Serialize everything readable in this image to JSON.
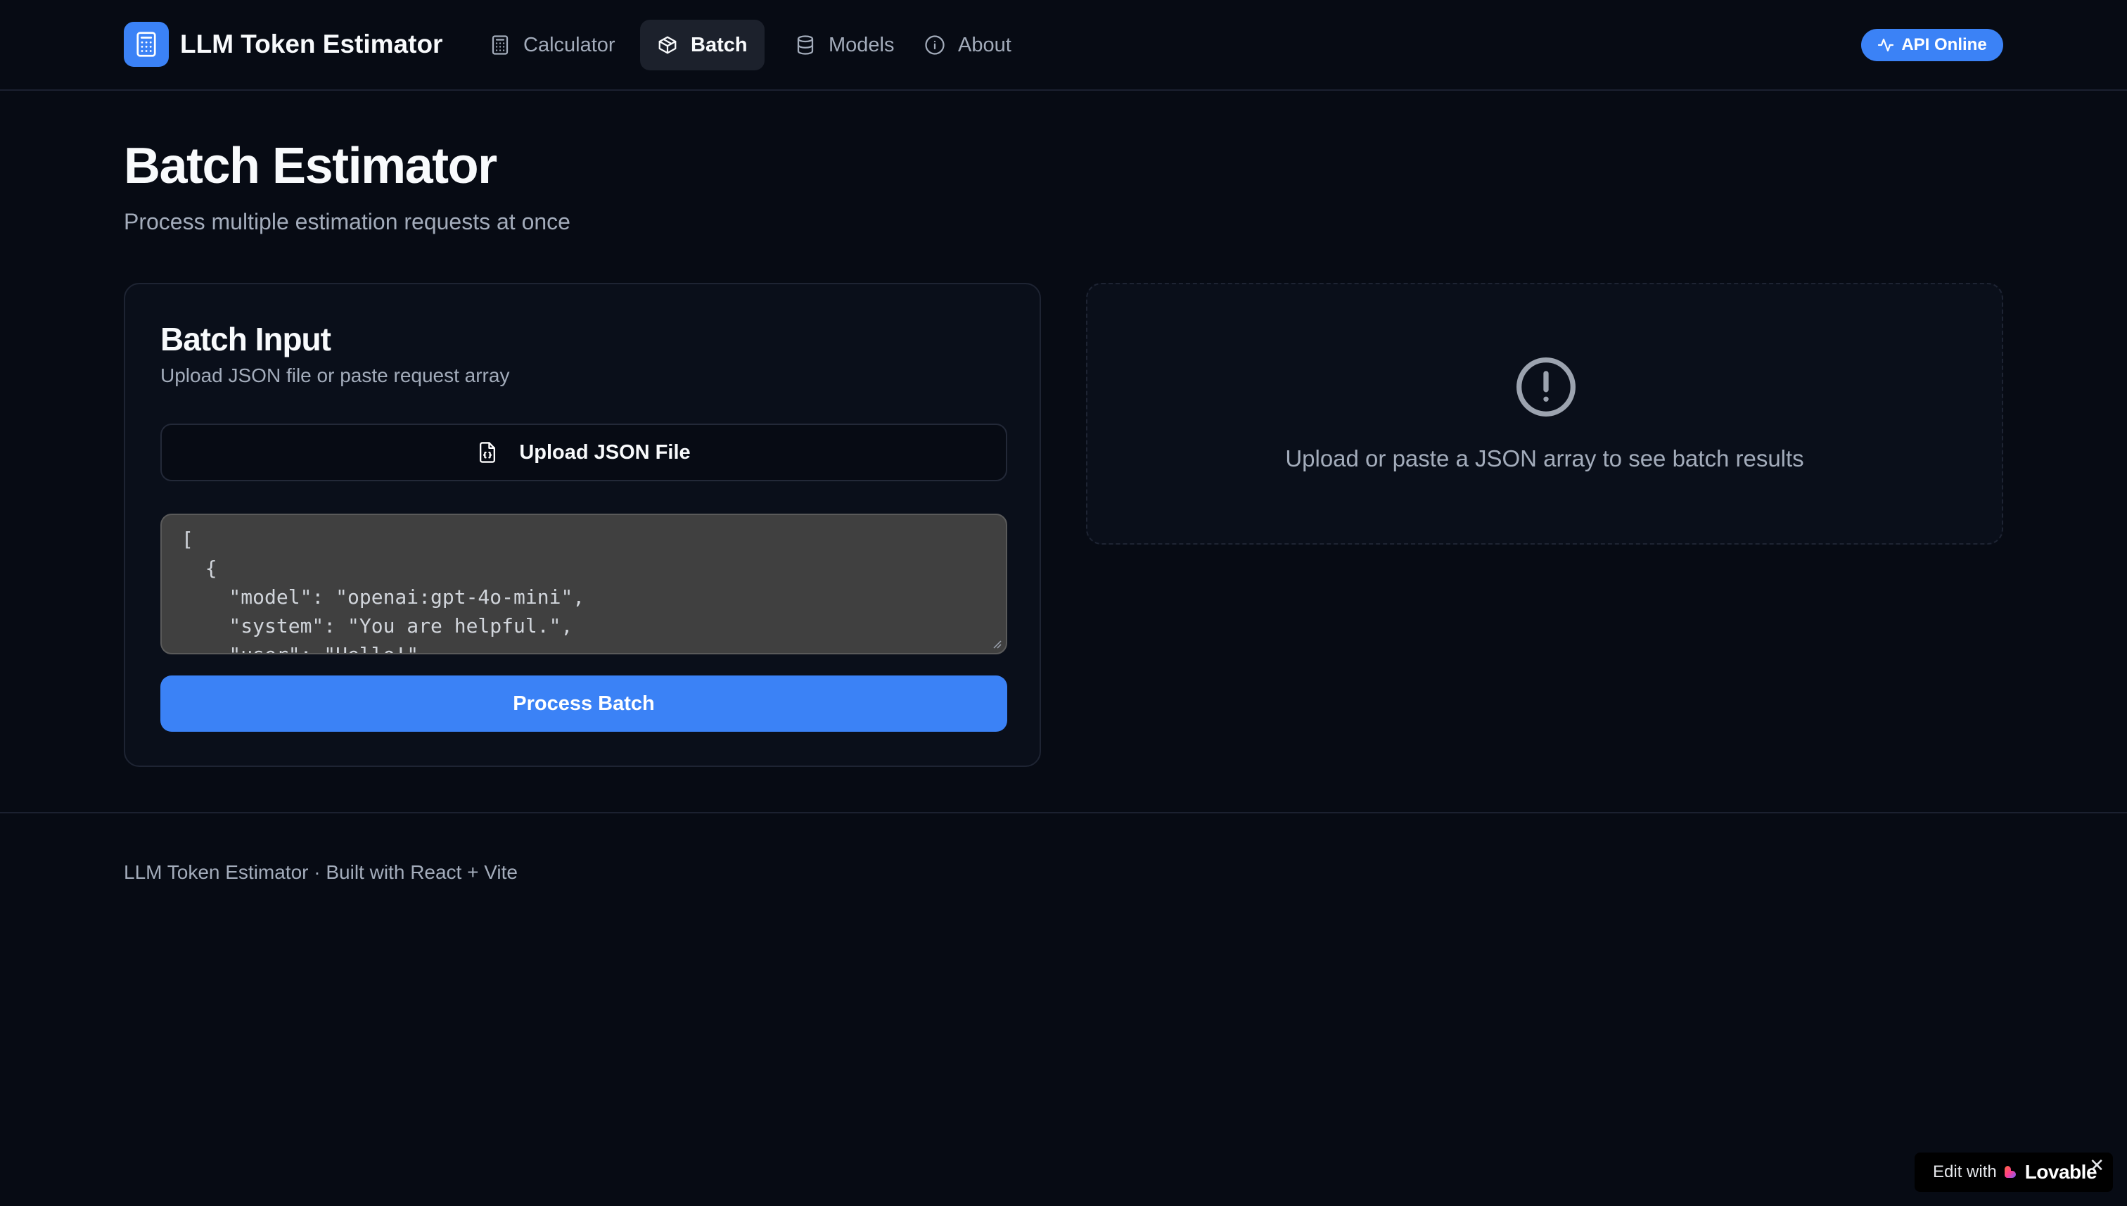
{
  "app": {
    "title": "LLM Token Estimator",
    "logo_icon": "calculator-icon"
  },
  "nav": {
    "items": [
      {
        "label": "Calculator",
        "icon": "calculator-icon",
        "active": false
      },
      {
        "label": "Batch",
        "icon": "package-icon",
        "active": true
      },
      {
        "label": "Models",
        "icon": "database-icon",
        "active": false
      },
      {
        "label": "About",
        "icon": "info-icon",
        "active": false
      }
    ]
  },
  "status": {
    "label": "API Online",
    "icon": "activity-icon",
    "color": "#3b82f6"
  },
  "page": {
    "title": "Batch Estimator",
    "subtitle": "Process multiple estimation requests at once"
  },
  "batch_input": {
    "title": "Batch Input",
    "description": "Upload JSON file or paste request array",
    "upload_label": "Upload JSON File",
    "upload_icon": "file-json-icon",
    "json_value": "[\n  {\n    \"model\": \"openai:gpt-4o-mini\",\n    \"system\": \"You are helpful.\",\n    \"user\": \"Hello!\"",
    "process_label": "Process Batch"
  },
  "results": {
    "icon": "alert-circle-icon",
    "empty_message": "Upload or paste a JSON array to see batch results"
  },
  "footer": {
    "text": "LLM Token Estimator · Built with React + Vite"
  },
  "badge": {
    "edit_label": "Edit with",
    "brand": "Lovable",
    "close": "✕"
  },
  "colors": {
    "background": "#070b14",
    "accent": "#3b82f6",
    "muted_text": "#a3acbb"
  }
}
